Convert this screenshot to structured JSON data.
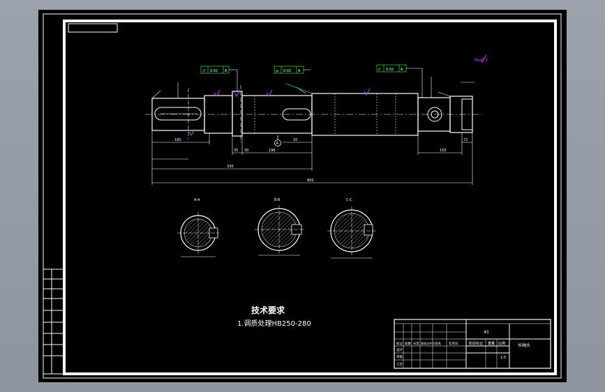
{
  "drawing": {
    "sections": {
      "a": "A-A",
      "b": "B-B",
      "c": "C-C"
    },
    "datum_label": "A",
    "dimensions": {
      "d180": "180",
      "d330": "330",
      "d800": "800",
      "d35": "35",
      "d30": "30",
      "d10": "10",
      "d196": "196",
      "d150": "150",
      "d72": "72"
    },
    "tolerance_frames": [
      {
        "symbol": "//",
        "value": "0.02",
        "datum": "A"
      },
      {
        "symbol": "◎",
        "value": "0.02",
        "datum": "A"
      },
      {
        "symbol": "//",
        "value": "0.02",
        "datum": "A"
      }
    ],
    "roughness_mark": "Ra 3.2",
    "tech_requirements": {
      "title": "技术要求",
      "item1": "1.调质处理HB250-280"
    },
    "title_block": {
      "material": "45",
      "part_name": "长轴头",
      "row_labels": [
        "标记",
        "处数",
        "分区",
        "更改文件号",
        "签名",
        "年月日"
      ],
      "stage_labels": [
        "阶段标记",
        "重量",
        "比例"
      ],
      "scale": "1:5",
      "left_labels": [
        "设计",
        "审核",
        "工艺"
      ]
    },
    "colors": {
      "background": "#000000",
      "line": "#ffffff",
      "dimension": "#ffffff",
      "roughness": "#c040ff",
      "tolerance": "#2ecc40"
    }
  }
}
